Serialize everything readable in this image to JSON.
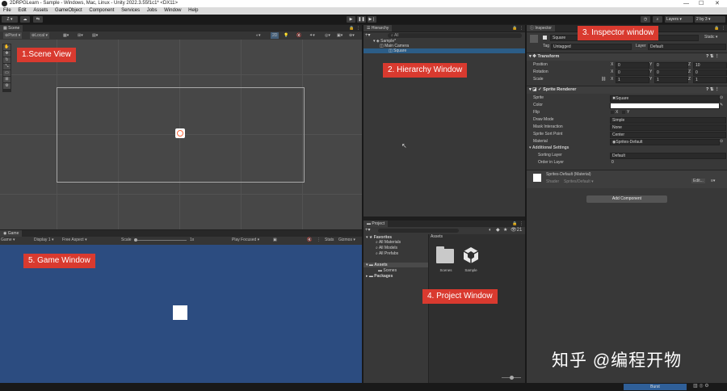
{
  "window": {
    "title": "2DRPGLearn - Sample - Windows, Mac, Linux - Unity 2022.3.55f1c1* <DX11>"
  },
  "menu": [
    "File",
    "Edit",
    "Assets",
    "GameObject",
    "Component",
    "Services",
    "Jobs",
    "Window",
    "Help"
  ],
  "toolbar": {
    "account": "Z",
    "layers": "Layers",
    "layout": "2 by 3"
  },
  "scene": {
    "tab": "Scene",
    "pivot": "Pivot",
    "local": "Local",
    "mode2d": "2D",
    "label": "1.Scene View"
  },
  "game": {
    "tab": "Game",
    "mode": "Game",
    "display": "Display 1",
    "aspect": "Free Aspect",
    "scale_label": "Scale",
    "scale_value": "1x",
    "play_focused": "Play Focused",
    "stats": "Stats",
    "gizmos": "Gizmos",
    "label": "5. Game Window"
  },
  "hierarchy": {
    "tab": "Hierarchy",
    "search": "All",
    "scene_name": "Sample*",
    "items": [
      "Main Camera",
      "Square"
    ],
    "label": "2. Hierarchy Window"
  },
  "project": {
    "tab": "Project",
    "favorites": "Favorites",
    "fav_items": [
      "All Materials",
      "All Models",
      "All Prefabs"
    ],
    "assets": "Assets",
    "asset_children": [
      "Scenes"
    ],
    "packages": "Packages",
    "breadcrumb": "Assets",
    "grid_items": [
      "Scenes",
      "Sample"
    ],
    "count": "21",
    "label": "4. Project Window"
  },
  "inspector": {
    "tab": "Inspector",
    "object_name": "Square",
    "static": "Static",
    "tag_label": "Tag",
    "tag_value": "Untagged",
    "layer_label": "Layer",
    "layer_value": "Default",
    "label": "3. Inspector window",
    "transform": {
      "title": "Transform",
      "position": {
        "label": "Position",
        "x": "0",
        "y": "0",
        "z": "10"
      },
      "rotation": {
        "label": "Rotation",
        "x": "0",
        "y": "0",
        "z": "0"
      },
      "scale": {
        "label": "Scale",
        "x": "1",
        "y": "1",
        "z": "1"
      }
    },
    "sprite_renderer": {
      "title": "Sprite Renderer",
      "sprite_label": "Sprite",
      "sprite_value": "Square",
      "color_label": "Color",
      "flip_label": "Flip",
      "flip_x": "X",
      "flip_y": "Y",
      "draw_mode_label": "Draw Mode",
      "draw_mode_value": "Simple",
      "mask_label": "Mask Interaction",
      "mask_value": "None",
      "sort_point_label": "Sprite Sort Point",
      "sort_point_value": "Center",
      "material_label": "Material",
      "material_value": "Sprites-Default",
      "additional": "Additional Settings",
      "sorting_layer_label": "Sorting Layer",
      "sorting_layer_value": "Default",
      "order_label": "Order in Layer",
      "order_value": "0"
    },
    "material_block": {
      "name": "Sprites-Default (Material)",
      "shader_label": "Shader",
      "shader_value": "Sprites/Default",
      "edit": "Edit..."
    },
    "add_component": "Add Component"
  },
  "status": {
    "burst": "Burst"
  },
  "watermark": "知乎 @编程开物",
  "colors": {
    "label_red": "#d93a2f",
    "game_bg": "#2c4c80",
    "selection": "#2c5d87"
  }
}
